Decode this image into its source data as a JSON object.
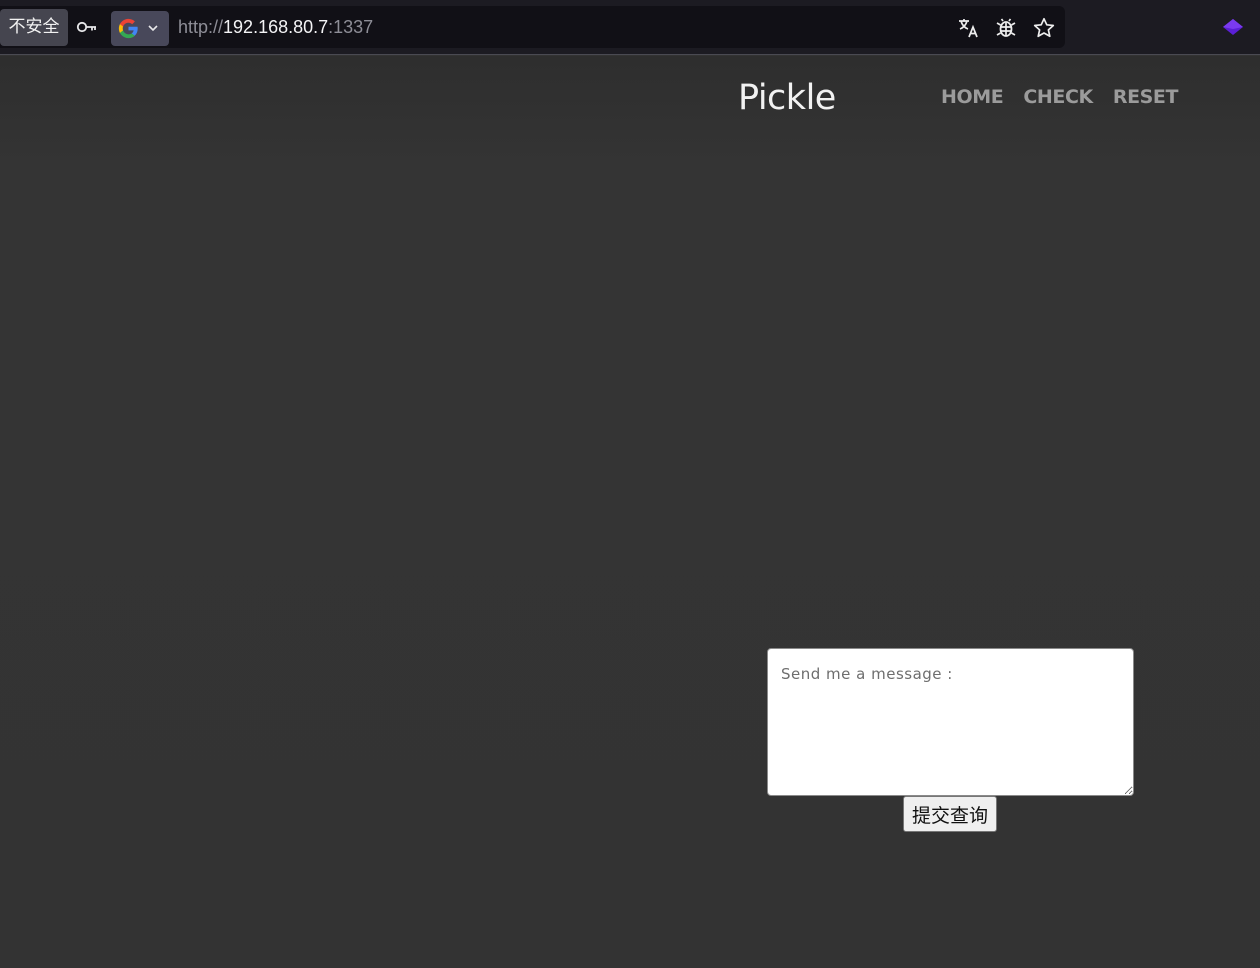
{
  "browser": {
    "security_label": "不安全",
    "url": {
      "scheme": "http://",
      "host": "192.168.80.7",
      "port": ":1337"
    },
    "icons": [
      "key-icon",
      "google-icon",
      "chevron-down-icon",
      "translate-icon",
      "bug-icon",
      "star-icon",
      "extension-icon"
    ]
  },
  "site": {
    "title": "Pickle",
    "nav": [
      "HOME",
      "CHECK",
      "RESET"
    ]
  },
  "form": {
    "message_placeholder": "Send me a message :",
    "submit_label": "提交查询"
  },
  "colors": {
    "page_background": "#333333",
    "title_color": "#f2f2f2",
    "nav_color": "#9b9b9b",
    "extension_accent": "#5b1fd6"
  }
}
